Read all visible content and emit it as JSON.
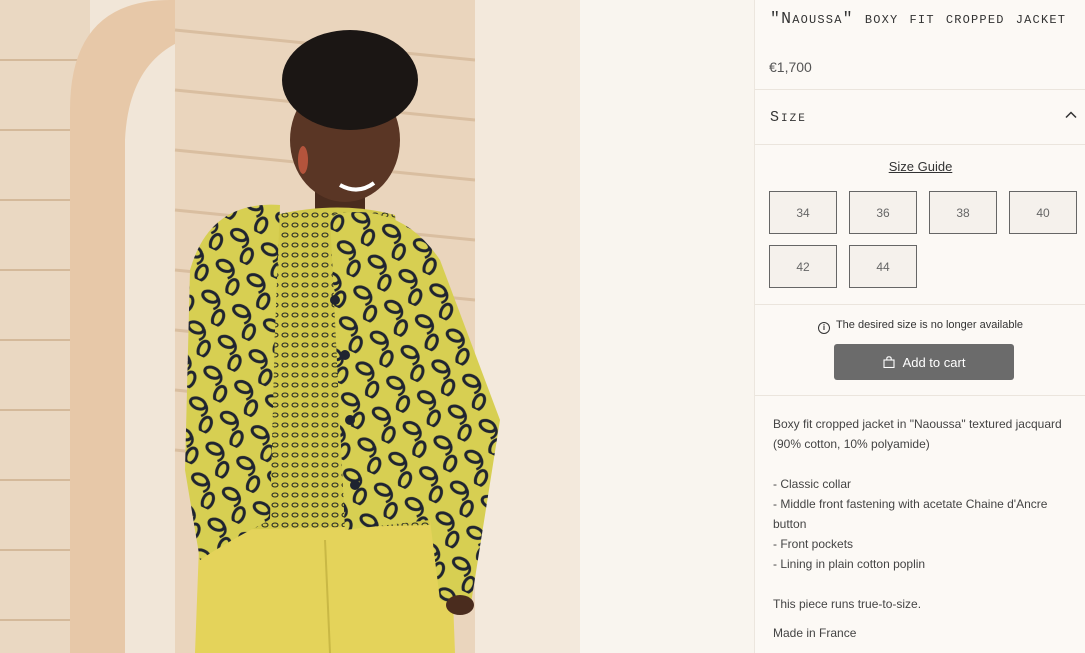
{
  "product": {
    "title": "\"Naoussa\" boxy fit cropped jacket",
    "price": "€1,700",
    "image_alt": "Model wearing a yellow Naoussa jacquard cropped jacket"
  },
  "size_section": {
    "label": "Size",
    "expanded": true,
    "guide_label": "Size Guide",
    "options": [
      "34",
      "36",
      "38",
      "40",
      "42",
      "44"
    ],
    "availability_note": "The desired size is no longer available"
  },
  "cart": {
    "label": "Add to cart"
  },
  "description": {
    "intro": "Boxy fit cropped jacket in \"Naoussa\" textured jacquard (90% cotton, 10% polyamide)",
    "features": [
      "- Classic collar",
      "- Middle front fastening with acetate Chaine d'Ancre button",
      "- Front pockets",
      "- Lining in plain cotton poplin"
    ],
    "fit_note": "This piece runs true-to-size.",
    "origin": "Made in France"
  },
  "colors": {
    "jacket": "#d8cf4f",
    "pattern": "#1f2430",
    "button_disabled": "#6b6b6b",
    "background": "#fcf9f5"
  }
}
